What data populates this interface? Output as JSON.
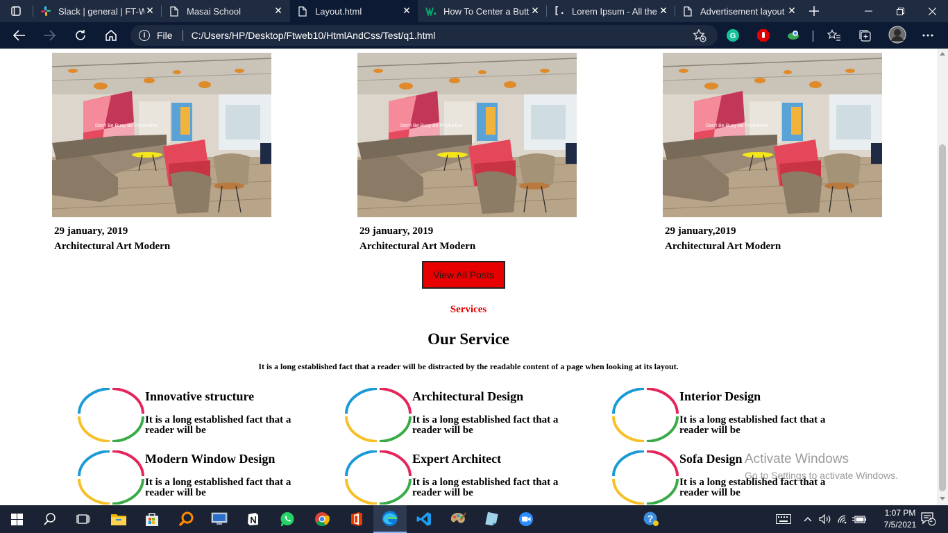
{
  "browser": {
    "tabs": [
      {
        "title": "Slack | general | FT-WE",
        "icon": "slack-icon",
        "active": false
      },
      {
        "title": "Masai School",
        "icon": "page-icon",
        "active": false
      },
      {
        "title": "Layout.html",
        "icon": "page-icon",
        "active": true
      },
      {
        "title": "How To Center a Butto",
        "icon": "w3-icon",
        "active": false
      },
      {
        "title": "Lorem Ipsum - All the",
        "icon": "lorem-icon",
        "active": false
      },
      {
        "title": "Advertisement layout",
        "icon": "page-icon",
        "active": false
      }
    ],
    "address": {
      "scheme_label": "File",
      "url": "C:/Users/HP/Desktop/Ftweb10/HtmlAndCss/Test/q1.html"
    }
  },
  "page": {
    "posts": [
      {
        "date": "29 january, 2019",
        "title": "Architectural Art Modern"
      },
      {
        "date": "29 january, 2019",
        "title": "Architectural Art Modern"
      },
      {
        "date": "29 january,2019",
        "title": "Architectural Art Modern"
      }
    ],
    "view_all_label": "View All Posts",
    "services_eyebrow": "Services",
    "services_heading": "Our Service",
    "services_intro": "It is a long established fact that a reader will be distracted by the readable content of a page when looking at its layout.",
    "services": [
      {
        "title": "Innovative structure",
        "desc": "It is a long established fact that a reader will be"
      },
      {
        "title": "Architectural Design",
        "desc": "It is a long established fact that a reader will be"
      },
      {
        "title": "Interior Design",
        "desc": "It is a long established fact that a reader will be"
      },
      {
        "title": "Modern Window Design",
        "desc": "It is a long established fact that a reader will be"
      },
      {
        "title": "Expert Architect",
        "desc": "It is a long established fact that a reader will be"
      },
      {
        "title": "Sofa Design",
        "desc": "It is a long established fact that a reader will be"
      }
    ],
    "colors": {
      "accent_red": "#e80000",
      "ring_blue": "#1a9ad6",
      "ring_red": "#e5245c",
      "ring_yellow": "#f6c026",
      "ring_green": "#3aaa47"
    }
  },
  "watermark": {
    "line1": "Activate Windows",
    "line2": "Go to Settings to activate Windows."
  },
  "taskbar": {
    "time": "1:07 PM",
    "date": "7/5/2021",
    "notification_count": "1"
  }
}
